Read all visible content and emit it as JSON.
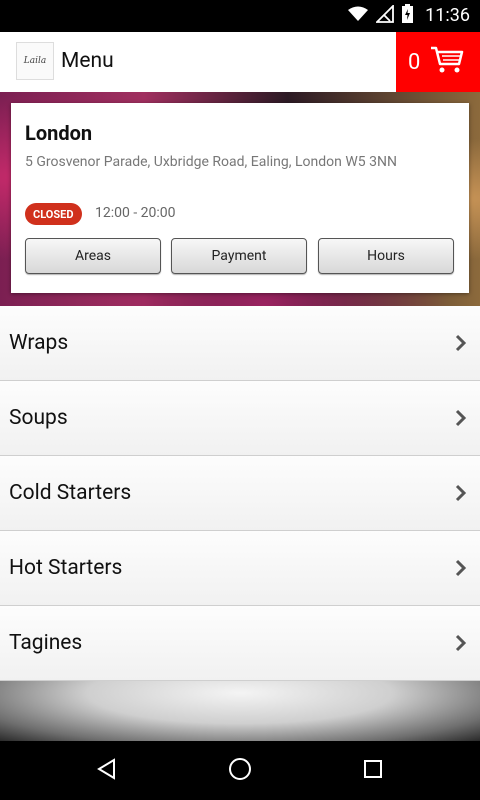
{
  "status_bar": {
    "time": "11:36",
    "icons": [
      "wifi-icon",
      "no-signal-icon",
      "battery-charging-icon"
    ]
  },
  "app_bar": {
    "logo_text": "Laila",
    "title": "Menu",
    "cart_count": "0"
  },
  "location": {
    "city": "London",
    "address": "5 Grosvenor Parade, Uxbridge Road, Ealing, London W5 3NN",
    "status": "CLOSED",
    "hours": "12:00 - 20:00",
    "status_color": "#d0301c"
  },
  "buttons": {
    "areas": "Areas",
    "payment": "Payment",
    "hours": "Hours"
  },
  "menu": {
    "items": [
      {
        "label": "Wraps"
      },
      {
        "label": "Soups"
      },
      {
        "label": "Cold Starters"
      },
      {
        "label": "Hot Starters"
      },
      {
        "label": "Tagines"
      }
    ]
  },
  "colors": {
    "accent": "#ff0000"
  }
}
